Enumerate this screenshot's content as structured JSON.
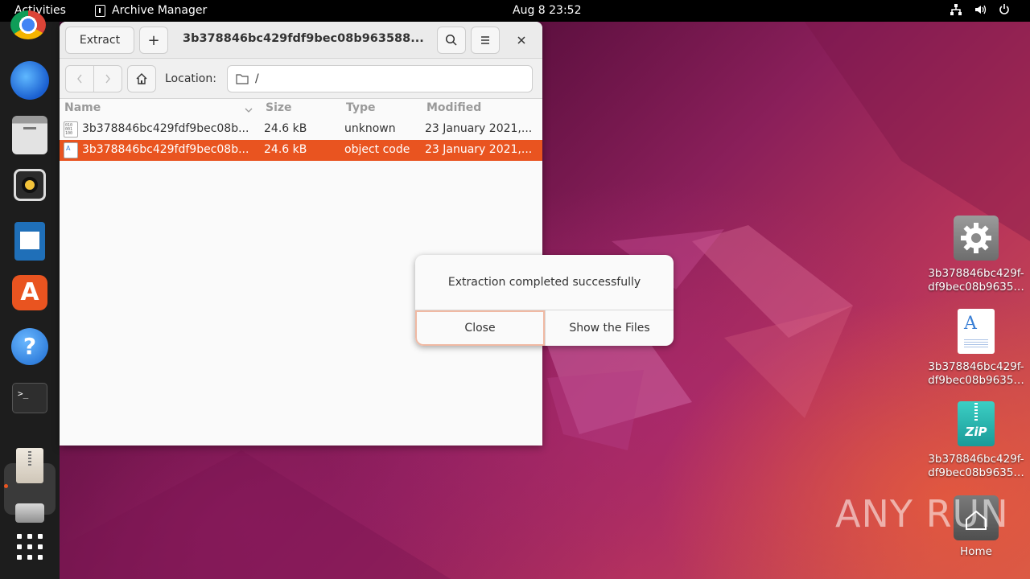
{
  "topbar": {
    "activities": "Activities",
    "app_name": "Archive Manager",
    "clock": "Aug 8  23:52"
  },
  "dock": {
    "items": [
      "chrome-icon",
      "thunderbird-icon",
      "files-icon",
      "rhythmbox-icon",
      "writer-icon",
      "app-center-icon",
      "help-icon",
      "terminal-icon",
      "archive-manager-icon",
      "drive-icon",
      "show-apps-icon"
    ]
  },
  "window": {
    "extract_label": "Extract",
    "add_label": "+",
    "title": "3b378846bc429fdf9bec08b963588...",
    "location_label": "Location:",
    "location_value": "/",
    "columns": [
      "Name",
      "Size",
      "Type",
      "Modified"
    ],
    "rows": [
      {
        "name": "3b378846bc429fdf9bec08b...",
        "size": "24.6 kB",
        "type": "unknown",
        "modified": "23 January 2021,..."
      },
      {
        "name": "3b378846bc429fdf9bec08b...",
        "size": "24.6 kB",
        "type": "object code",
        "modified": "23 January 2021,..."
      }
    ]
  },
  "dialog": {
    "message": "Extraction completed successfully",
    "close_label": "Close",
    "show_label": "Show the Files"
  },
  "desktop": {
    "icons": [
      {
        "line1": "3b378846bc429f-",
        "line2": "df9bec08b9635…"
      },
      {
        "line1": "3b378846bc429f-",
        "line2": "df9bec08b9635…"
      },
      {
        "line1": "3b378846bc429f-",
        "line2": "df9bec08b9635…"
      },
      {
        "line1": "Home",
        "line2": ""
      }
    ]
  },
  "watermark": "ANY RUN",
  "colors": {
    "accent": "#e95420",
    "topbar": "#000000",
    "dock": "#1d1d1d"
  }
}
